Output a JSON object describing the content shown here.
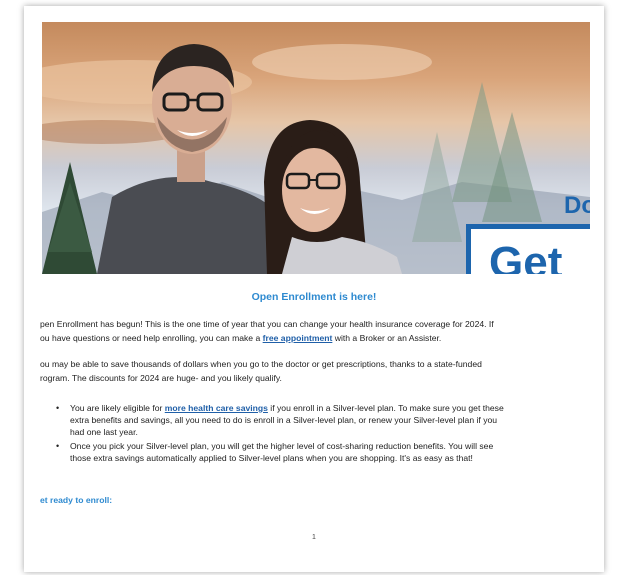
{
  "hero": {
    "headline_fragment": "Do",
    "button_fragment": "Get"
  },
  "heading": "Open Enrollment is here!",
  "intro": {
    "line1": "pen Enrollment has begun! This is the one time of year that you can change your health insurance coverage for 2024.  If",
    "line2_before": "ou have questions or need help enrolling, you can make a ",
    "line2_link": "free appointment",
    "line2_after": " with a Broker or an Assister."
  },
  "savings": {
    "line1": "ou may be able to save thousands of dollars when you go to the doctor or get prescriptions, thanks to a state-funded",
    "line2": "rogram. The discounts for 2024 are huge- and you likely qualify."
  },
  "bullets": [
    {
      "line1_before": "You are likely eligible for ",
      "line1_link": "more health care savings",
      "line1_after": " if you enroll in a Silver-level plan. To make sure you get these",
      "line2": "extra benefits and savings, all you need to do is enroll in a Silver-level plan, or renew your Silver-level plan if you",
      "line3": "had one last year."
    },
    {
      "line1": "Once you pick your Silver-level plan, you will get the higher level of cost-sharing reduction benefits. You will see",
      "line2": "those extra savings automatically applied to Silver-level plans when you are shopping. It's as easy as that!"
    }
  ],
  "get_ready": "et ready to enroll:",
  "page_number": "1",
  "colors": {
    "accent_blue": "#1d65ad",
    "heading_blue": "#2e8ad0",
    "link_blue": "#1f5fa8"
  }
}
